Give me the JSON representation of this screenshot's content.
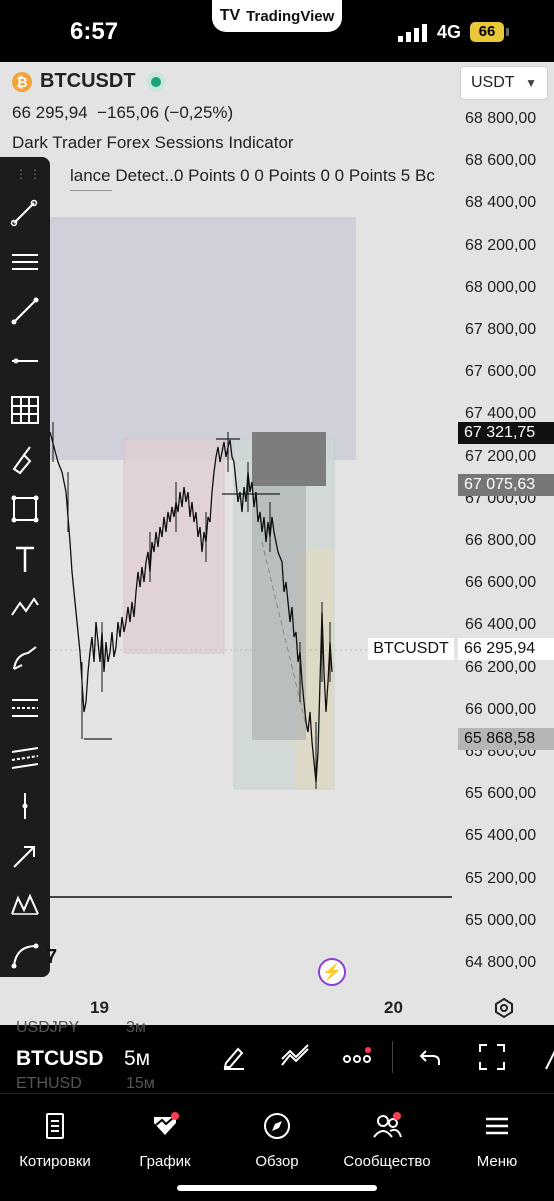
{
  "status": {
    "time": "6:57",
    "network": "4G",
    "battery": "66",
    "app_pill": "TradingView"
  },
  "header": {
    "symbol": "BTCUSDT",
    "price": "66 295,94",
    "change": "−165,06 (−0,25%)",
    "indicator1": "Dark Trader Forex Sessions Indicator",
    "indicator2_name": "lance Detect...",
    "indicator2_values": "0 Points 0 0 Points 0 0 Points 5 Bc",
    "currency": "USDT"
  },
  "price_axis": [
    "68 800,00",
    "68 600,00",
    "68 400,00",
    "68 200,00",
    "68 000,00",
    "67 800,00",
    "67 600,00",
    "67 400,00",
    "67 200,00",
    "67 000,00",
    "66 800,00",
    "66 600,00",
    "66 400,00",
    "66 200,00",
    "66 000,00",
    "65 800,00",
    "65 600,00",
    "65 400,00",
    "65 200,00",
    "65 000,00",
    "64 800,00"
  ],
  "tags": {
    "high": "67 321,75",
    "mid": "67 075,63",
    "last_symbol": "BTCUSDT",
    "last": "66 295,94",
    "low": "65 868,58"
  },
  "time_axis": {
    "day1": "19",
    "day2": "20"
  },
  "chart_label_7": "7",
  "bottom": {
    "symbol": "BTCUSD",
    "interval": "5м",
    "ghost1_sym": "USDJPY",
    "ghost1_int": "3м",
    "ghost2_sym": "ETHUSD",
    "ghost2_int": "15м"
  },
  "nav": [
    {
      "label": "Котировки",
      "icon": "quotes-icon"
    },
    {
      "label": "График",
      "icon": "chart-icon"
    },
    {
      "label": "Обзор",
      "icon": "compass-icon"
    },
    {
      "label": "Сообщество",
      "icon": "community-icon"
    },
    {
      "label": "Меню",
      "icon": "menu-icon"
    }
  ],
  "colors": {
    "accent": "#1aa37a",
    "badge": "#ff3b4f",
    "bitcoin": "#f2a33a"
  }
}
